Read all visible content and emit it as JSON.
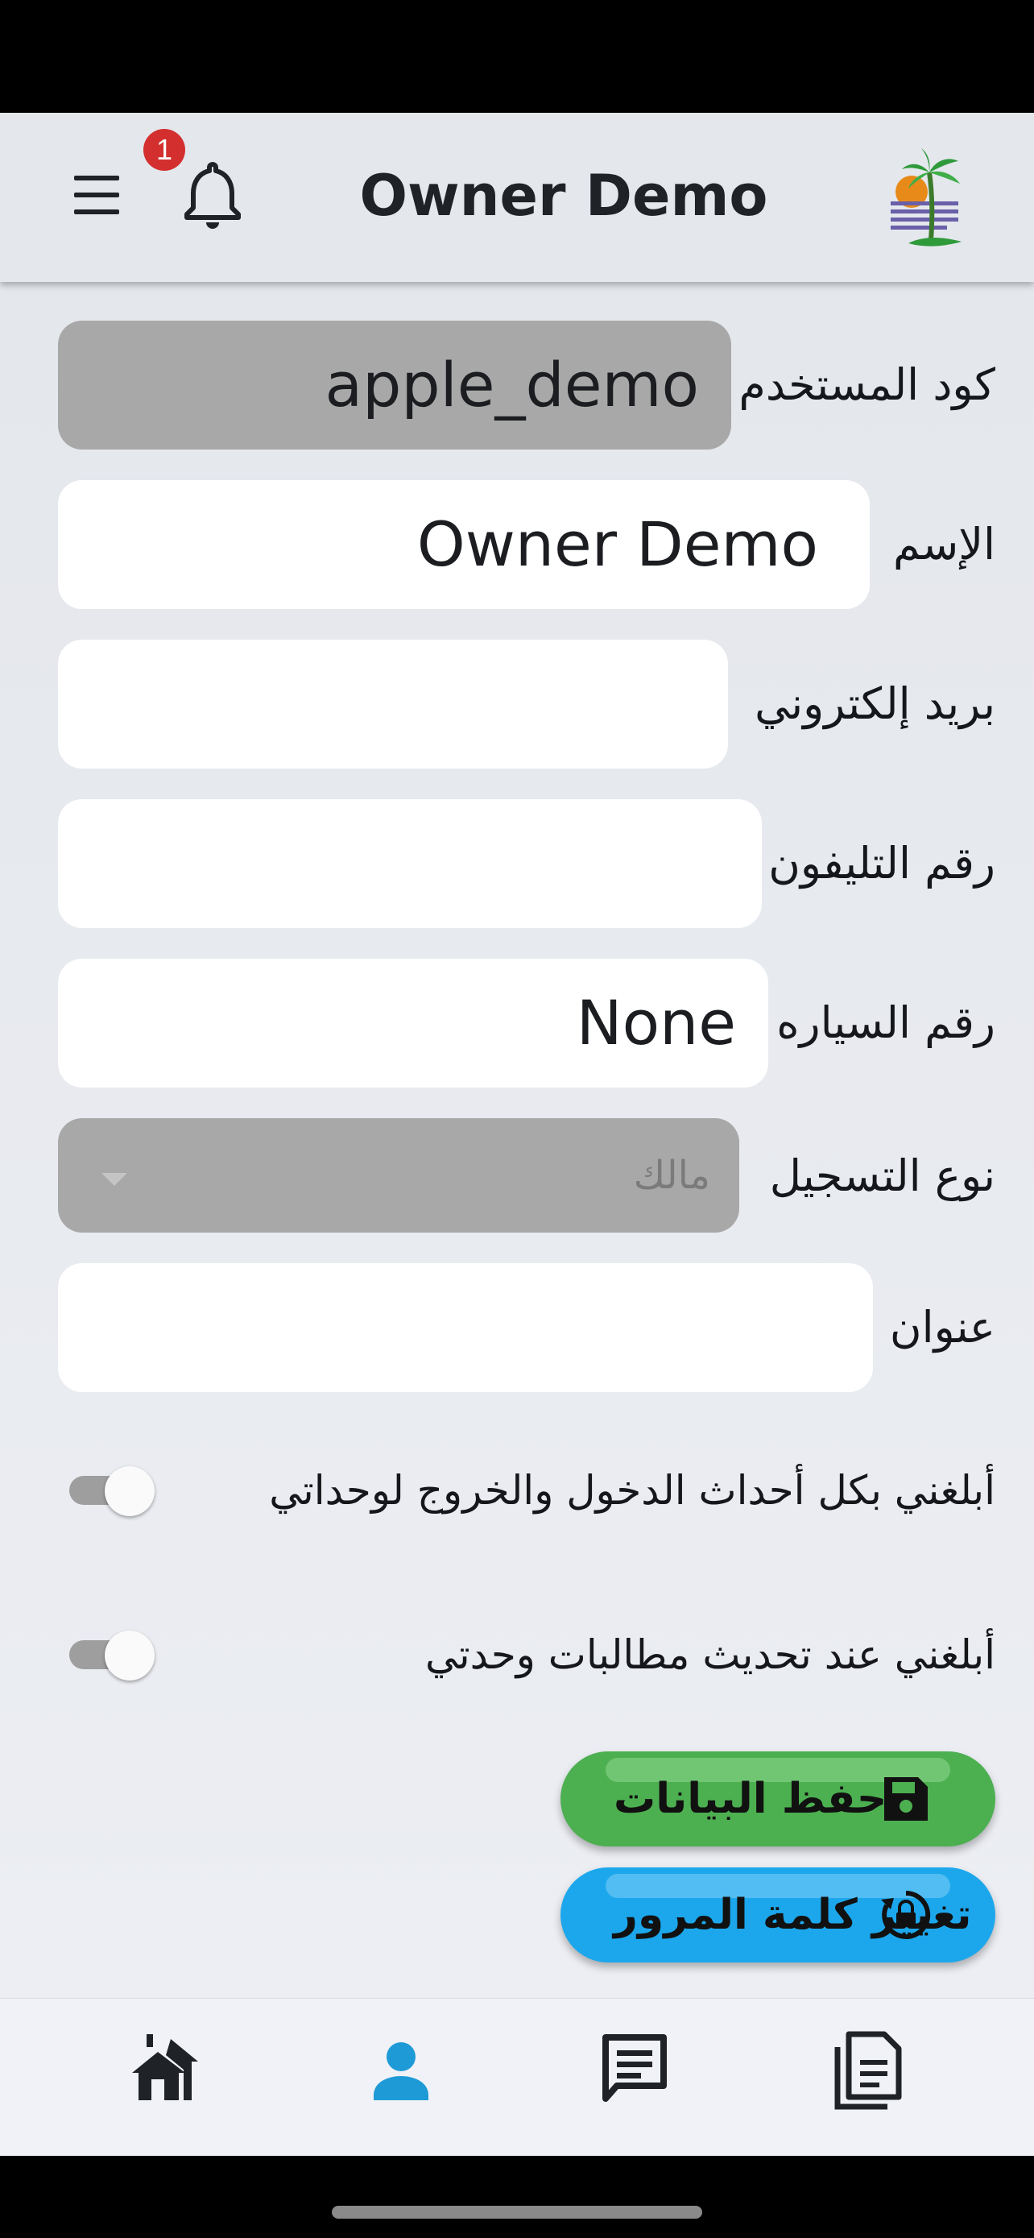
{
  "app_bar": {
    "title": "Owner Demo",
    "notification_count": "1"
  },
  "form": {
    "username": {
      "label": "كود المستخدم",
      "value": "apple_demo"
    },
    "name": {
      "label": "الإسم",
      "value": "Owner Demo"
    },
    "email": {
      "label": "بريد إلكتروني",
      "value": ""
    },
    "phone": {
      "label": "رقم التليفون",
      "value": ""
    },
    "car_number": {
      "label": "رقم السياره",
      "value": "None"
    },
    "registration_type": {
      "label": "نوع التسجيل",
      "value": "مالك"
    },
    "address": {
      "label": "عنوان",
      "value": ""
    }
  },
  "toggles": {
    "entry_exit": {
      "label": "أبلغني بكل أحداث الدخول والخروج لوحداتي",
      "on": false
    },
    "claims_update": {
      "label": "أبلغني عند تحديث مطالبات وحدتي",
      "on": false
    }
  },
  "buttons": {
    "save": {
      "label": "حفظ البيانات",
      "color": "#4caf50"
    },
    "change_password": {
      "label": "تغيير كلمة المرور",
      "color": "#1ca7ec"
    }
  },
  "bottom_nav": {
    "active_color": "#1e9ad6",
    "inactive_color": "#1f2227",
    "items": [
      {
        "icon": "home-icon",
        "active": false
      },
      {
        "icon": "person-icon",
        "active": true
      },
      {
        "icon": "chat-icon",
        "active": false
      },
      {
        "icon": "document-icon",
        "active": false
      }
    ]
  }
}
